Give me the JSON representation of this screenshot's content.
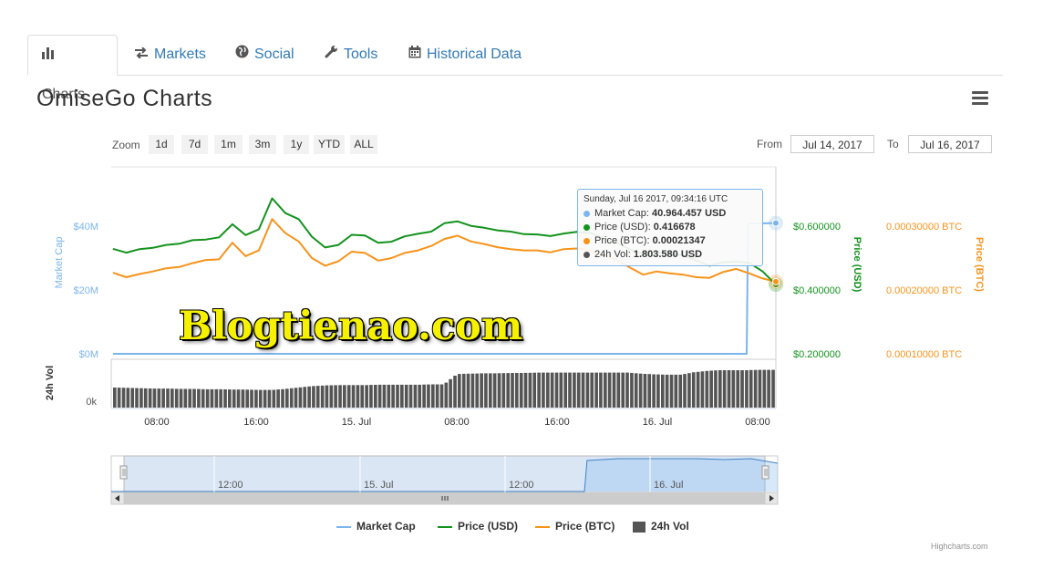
{
  "tabs": [
    {
      "label": "Charts",
      "icon": "bar-chart-icon",
      "active": true
    },
    {
      "label": "Markets",
      "icon": "exchange-icon"
    },
    {
      "label": "Social",
      "icon": "globe-icon"
    },
    {
      "label": "Tools",
      "icon": "wrench-icon"
    },
    {
      "label": "Historical Data",
      "icon": "calendar-icon"
    }
  ],
  "page_title": "OmiseGo Charts",
  "range_selector": {
    "zoom_label": "Zoom",
    "buttons": [
      "1d",
      "7d",
      "1m",
      "3m",
      "1y",
      "YTD",
      "ALL"
    ],
    "from_label": "From",
    "from_value": "Jul 14, 2017",
    "to_label": "To",
    "to_value": "Jul 16, 2017"
  },
  "tooltip": {
    "header": "Sunday, Jul 16 2017, 09:34:16 UTC",
    "rows": [
      {
        "label": "Market Cap",
        "value": "40.964.457 USD",
        "color": "#7cb5ec"
      },
      {
        "label": "Price (USD)",
        "value": "0.416678",
        "color": "#13921d"
      },
      {
        "label": "Price (BTC)",
        "value": "0.00021347",
        "color": "#f7931a"
      },
      {
        "label": "24h Vol",
        "value": "1.803.580 USD",
        "color": "#555555"
      }
    ]
  },
  "watermark": "Blogtienao.com",
  "credits": "Highcharts.com",
  "colors": {
    "market_cap": "#7cb5ec",
    "price_usd": "#13921d",
    "price_btc": "#f7931a",
    "volume": "#555555",
    "tab_link": "#337ab7"
  },
  "chart_data": {
    "type": "line",
    "axes": {
      "market_cap": {
        "title": "Market Cap",
        "ticks": [
          "$0M",
          "$20M",
          "$40M"
        ],
        "range": [
          0,
          40000000
        ]
      },
      "price_usd": {
        "title": "Price (USD)",
        "ticks": [
          "$0.200000",
          "$0.400000",
          "$0.600000"
        ],
        "range": [
          0.2,
          0.6
        ]
      },
      "price_btc": {
        "title": "Price (BTC)",
        "ticks": [
          "0.00010000 BTC",
          "0.00020000 BTC",
          "0.00030000 BTC"
        ],
        "range": [
          0.0001,
          0.0003
        ]
      },
      "volume": {
        "title": "24h Vol",
        "ticks": [
          "0k"
        ]
      },
      "x": {
        "ticks": [
          "08:00",
          "16:00",
          "15. Jul",
          "08:00",
          "16:00",
          "16. Jul",
          "08:00"
        ]
      }
    },
    "navigator_ticks": [
      "12:00",
      "15. Jul",
      "12:00",
      "16. Jul"
    ],
    "x_hours": [
      0,
      1,
      2,
      3,
      4,
      5,
      6,
      7,
      8,
      9,
      10,
      11,
      12,
      13,
      14,
      15,
      16,
      17,
      18,
      19,
      20,
      21,
      22,
      23,
      24,
      25,
      26,
      27,
      28,
      29,
      30,
      31,
      32,
      33,
      34,
      35,
      36,
      37,
      38,
      39,
      40,
      41,
      42,
      43,
      44,
      45,
      46,
      47,
      48,
      49,
      50
    ],
    "series": [
      {
        "name": "Price (USD)",
        "axis": "price_usd",
        "values": [
          0.529,
          0.517,
          0.528,
          0.532,
          0.541,
          0.545,
          0.556,
          0.558,
          0.565,
          0.606,
          0.572,
          0.59,
          0.687,
          0.641,
          0.622,
          0.567,
          0.533,
          0.541,
          0.573,
          0.571,
          0.548,
          0.551,
          0.568,
          0.576,
          0.583,
          0.609,
          0.615,
          0.601,
          0.595,
          0.587,
          0.583,
          0.575,
          0.574,
          0.569,
          0.577,
          0.582,
          0.579,
          0.562,
          0.548,
          0.527,
          0.512,
          0.518,
          0.513,
          0.509,
          0.492,
          0.476,
          0.487,
          0.489,
          0.485,
          0.458,
          0.417
        ]
      },
      {
        "name": "Price (BTC)",
        "axis": "price_btc",
        "values": [
          0.000227,
          0.00022,
          0.000225,
          0.000229,
          0.000234,
          0.000236,
          0.000242,
          0.000247,
          0.000248,
          0.000274,
          0.000253,
          0.000262,
          0.000311,
          0.000289,
          0.000276,
          0.00025,
          0.000238,
          0.000245,
          0.00026,
          0.000258,
          0.000246,
          0.00025,
          0.000258,
          0.000262,
          0.000269,
          0.00028,
          0.000285,
          0.000276,
          0.000272,
          0.000267,
          0.000264,
          0.000262,
          0.000262,
          0.000259,
          0.000264,
          0.000265,
          0.000262,
          0.000254,
          0.000247,
          0.000235,
          0.000224,
          0.000229,
          0.000226,
          0.000224,
          0.00022,
          0.000219,
          0.000228,
          0.000233,
          0.000226,
          0.000218,
          0.000213
        ]
      },
      {
        "name": "Market Cap",
        "axis": "market_cap",
        "values": [
          0,
          0,
          0,
          0,
          0,
          0,
          0,
          0,
          0,
          0,
          0,
          0,
          0,
          0,
          0,
          0,
          0,
          0,
          0,
          0,
          0,
          0,
          0,
          0,
          0,
          0,
          0,
          0,
          0,
          0,
          0,
          0,
          0,
          0,
          0,
          0,
          0,
          0,
          0,
          0,
          0,
          0,
          0,
          0,
          0,
          0,
          0,
          0,
          0,
          40800000,
          40964457
        ]
      }
    ],
    "volume_series": {
      "name": "24h Vol",
      "note": "relative heights",
      "values": [
        0.58,
        0.57,
        0.56,
        0.55,
        0.55,
        0.54,
        0.54,
        0.53,
        0.53,
        0.52,
        0.52,
        0.51,
        0.51,
        0.54,
        0.58,
        0.62,
        0.64,
        0.65,
        0.65,
        0.65,
        0.66,
        0.66,
        0.66,
        0.66,
        0.67,
        0.67,
        0.97,
        0.98,
        0.99,
        0.99,
        1.0,
        1.0,
        1.01,
        1.01,
        1.01,
        1.01,
        1.01,
        1.01,
        1.01,
        1.01,
        0.98,
        0.96,
        0.95,
        0.95,
        1.02,
        1.06,
        1.08,
        1.08,
        1.08,
        1.09,
        1.09
      ]
    },
    "legend": [
      {
        "name": "Market Cap",
        "color": "#7cb5ec",
        "symbol": "line"
      },
      {
        "name": "Price (USD)",
        "color": "#13921d",
        "symbol": "line"
      },
      {
        "name": "Price (BTC)",
        "color": "#f7931a",
        "symbol": "line"
      },
      {
        "name": "24h Vol",
        "color": "#555555",
        "symbol": "box"
      }
    ]
  }
}
